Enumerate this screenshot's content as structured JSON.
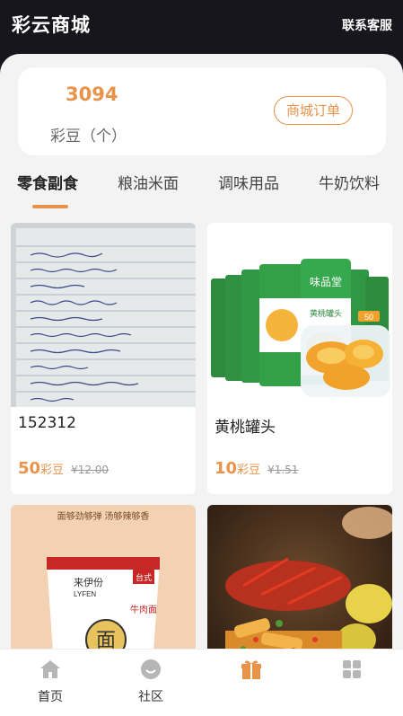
{
  "header": {
    "title": "彩云商城",
    "service_label": "联系客服"
  },
  "points": {
    "value": "3094",
    "unit_label": "彩豆（个）",
    "order_button": "商城订单"
  },
  "tabs": [
    {
      "label": "零食副食",
      "active": true
    },
    {
      "label": "粮油米面",
      "active": false
    },
    {
      "label": "调味用品",
      "active": false
    },
    {
      "label": "牛奶饮料",
      "active": false
    }
  ],
  "products": [
    {
      "name": "152312",
      "price": "50",
      "price_unit": "彩豆",
      "original_price": "¥12.00"
    },
    {
      "name": "黄桃罐头",
      "price": "10",
      "price_unit": "彩豆",
      "original_price": "¥1.51",
      "can_brand": "味品堂",
      "can_label": "黄桃罐头",
      "can_weight": "50"
    },
    {
      "banner": "面够劲够弹 汤够辣够香",
      "brand": "来伊份",
      "brand_en": "LYFEN",
      "cup_char": "面",
      "cup_label": "牛肉面",
      "badge": "台式"
    },
    {}
  ],
  "bottom_nav": [
    {
      "label": "首页",
      "icon": "home-icon"
    },
    {
      "label": "社区",
      "icon": "community-icon"
    },
    {
      "label": "",
      "icon": "gift-icon"
    },
    {
      "label": "",
      "icon": "grid-icon"
    }
  ],
  "colors": {
    "accent": "#e8924a",
    "header_bg": "#16161c",
    "page_bg": "#f3f3f3"
  }
}
